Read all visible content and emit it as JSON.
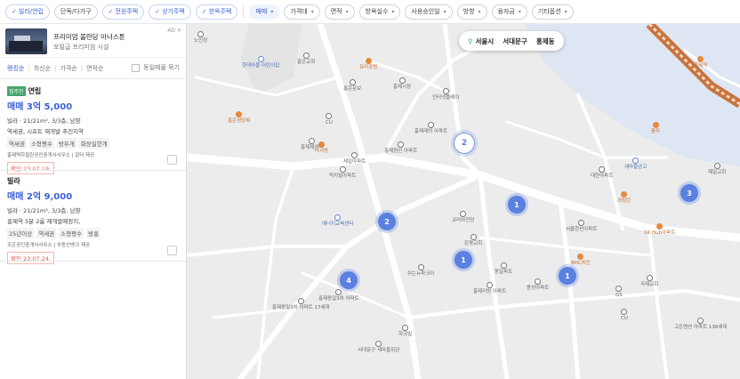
{
  "filters": [
    {
      "label": "빌라/연립",
      "state": "on",
      "check": true
    },
    {
      "label": "단독/다가구",
      "state": "plain",
      "check": false
    },
    {
      "label": "전원주택",
      "state": "on",
      "check": true
    },
    {
      "label": "상가주택",
      "state": "on",
      "check": true
    },
    {
      "label": "한옥주택",
      "state": "on",
      "check": true
    }
  ],
  "dropdowns": [
    "매매",
    "가격대",
    "면적",
    "방욕실수",
    "사용승인일",
    "방향",
    "융자금",
    "기타옵션"
  ],
  "ad": {
    "title": "프리미엄 불란당 아너스톤",
    "subtitle": "포털급 프리미엄 시설",
    "tag": "AD ✕"
  },
  "sort": {
    "options": [
      "랭킹순",
      "최신순",
      "가격순",
      "면적순"
    ],
    "group_label": "동일매물 묶기"
  },
  "listings": [
    {
      "badge": "집주인",
      "type": "연립",
      "price": "매매 3억 5,000",
      "line1": "빌라 · 21/21m², 3/3층, 남향",
      "line2": "역세권, 시프트 재개발 추진지역",
      "tags": [
        "역세권",
        "소형평수",
        "방두개",
        "화장실한개"
      ],
      "agent": "홍제역하힐란공인중개사사무소 | 알터 제공",
      "verified": "확인 23.07.19."
    },
    {
      "badge": "",
      "type": "빌라",
      "price": "매매 2억 9,000",
      "line1": "빌라 · 21/21m², 3/3층, 남향",
      "line2": "홍제역 5분 2룸 재개발예정지,",
      "tags": [
        "25년이상",
        "역세권",
        "소형평수",
        "방홍"
      ],
      "agent": "조은공인중개사사무소 | 부동산뱅크 제공",
      "verified": "확인 23.07.24."
    }
  ],
  "location": {
    "city": "서울시",
    "district": "서대문구",
    "dong": "홍제동"
  },
  "clusters": [
    {
      "count": "2",
      "style": "white"
    },
    {
      "count": "2",
      "style": "blue"
    },
    {
      "count": "1",
      "style": "blue"
    },
    {
      "count": "1",
      "style": "blue"
    },
    {
      "count": "4",
      "style": "blue"
    },
    {
      "count": "1",
      "style": "blue"
    },
    {
      "count": "3",
      "style": "blue"
    }
  ],
  "pois": [
    "노인정",
    "한데마을 어린이집",
    "홍은교회",
    "유리공원",
    "홍제시장",
    "인터넷플레이",
    "홍은문보",
    "홍은성당복",
    "CU",
    "홍제제센티",
    "홍제래의 아파트",
    "다시방",
    "제일아파트",
    "홍제원선 아파트",
    "럭키빌아파트",
    "대한아파트",
    "새마을금고",
    "풍자",
    "제일교회",
    "쾨링턴",
    "서울한신아파트",
    "SK Hub아파트",
    "코리아천당",
    "에너지교육센터",
    "은평교회",
    "쉬는뉴파크아",
    "동일파트",
    "용성아파트",
    "홍제리빙 아파트",
    "BHC치킨",
    "홍제동일3차 아파트 17세대",
    "하크빌",
    "서대문구 새마을회관",
    "홍제동일3차 아파트",
    "GS",
    "CU",
    "고은멘션 아파트 136세대",
    "국제교회",
    "홍제역"
  ],
  "colors": {
    "accent": "#3c5fd6",
    "cluster": "#5a80e0",
    "verified": "#e05c4b",
    "badge": "#44a56a",
    "subway_line": "#c8743c"
  }
}
